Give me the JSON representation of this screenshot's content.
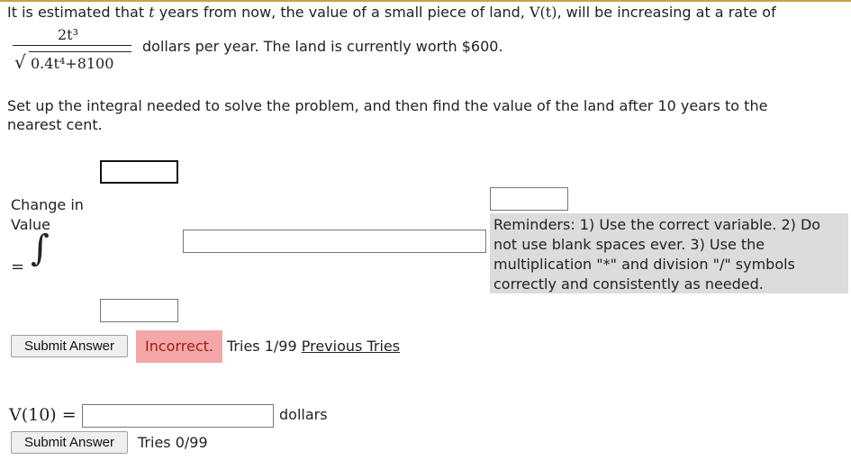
{
  "problem": {
    "line1_a": "It is estimated that",
    "var_t": "t",
    "line1_b": "years from now, the value of a small piece of land,",
    "func_V": "V(t)",
    "line1_c": ", will be increasing at a rate of",
    "numerator": "2t³",
    "denominator": "0.4t⁴+8100",
    "line2": "dollars per year. The land is currently worth $600.",
    "instructions": "Set up the integral needed to solve the problem, and then find the value of the land after 10 years to the nearest cent."
  },
  "integral": {
    "label_line1": "Change in",
    "label_line2": "Value",
    "equals": "=",
    "upper_limit_value": "",
    "lower_limit_value": "",
    "integrand_value": "",
    "differential_value": ""
  },
  "reminder": "Reminders: 1) Use the correct variable. 2) Do not use blank spaces ever. 3) Use the multiplication \"*\" and division \"/\" symbols correctly and consistently as needed.",
  "attempt1": {
    "submit_label": "Submit Answer",
    "result": "Incorrect.",
    "tries": "Tries 1/99",
    "previous_tries": "Previous Tries"
  },
  "part2": {
    "expr": "V(10)",
    "equals": "=",
    "answer_value": "",
    "unit": "dollars",
    "submit_label": "Submit Answer",
    "tries": "Tries 0/99"
  }
}
